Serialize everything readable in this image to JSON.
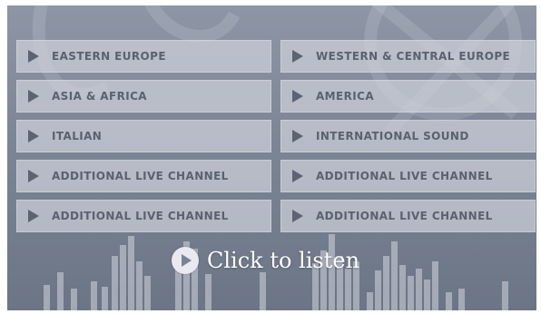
{
  "channels": [
    {
      "label": "EASTERN EUROPE"
    },
    {
      "label": "WESTERN & CENTRAL EUROPE"
    },
    {
      "label": "ASIA & AFRICA"
    },
    {
      "label": "AMERICA"
    },
    {
      "label": "ITALIAN"
    },
    {
      "label": "INTERNATIONAL SOUND"
    },
    {
      "label": "ADDITIONAL LIVE CHANNEL"
    },
    {
      "label": "ADDITIONAL LIVE CHANNEL"
    },
    {
      "label": "ADDITIONAL LIVE CHANNEL"
    },
    {
      "label": "ADDITIONAL LIVE CHANNEL"
    }
  ],
  "listen": {
    "label": "Click to listen"
  },
  "colors": {
    "panel_bg": "#7f8899",
    "button_bg": "#cdd1da",
    "button_text": "#5a6170",
    "listen_text": "#ffffff"
  },
  "icons": {
    "channel": "play-triangle-icon",
    "listen": "play-circle-icon"
  }
}
